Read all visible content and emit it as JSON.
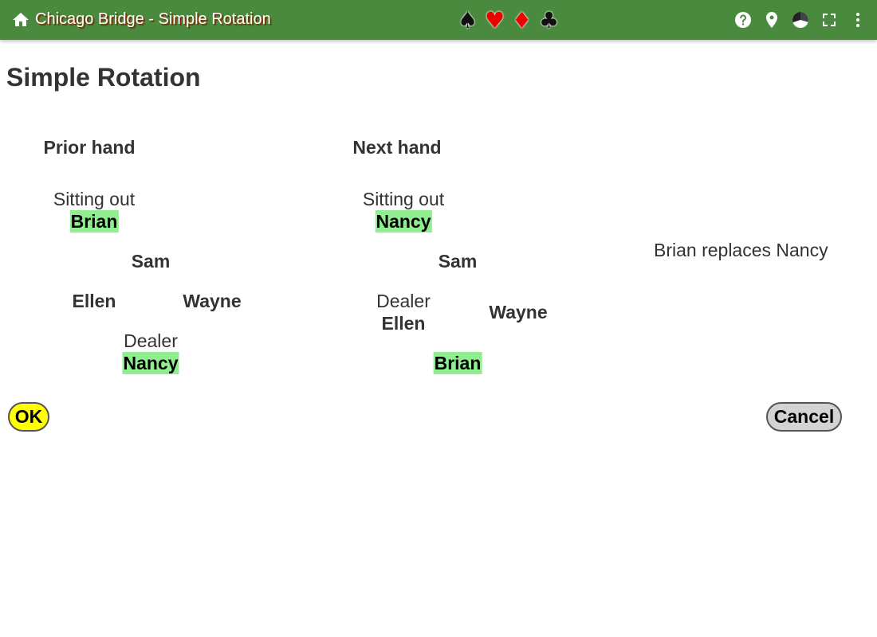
{
  "app_bar": {
    "title": "Chicago Bridge - Simple Rotation",
    "home_icon": "home-icon",
    "suits": [
      {
        "symbol": "♠",
        "name": "spade-icon",
        "color": "#111111"
      },
      {
        "symbol": "♥",
        "name": "heart-icon",
        "color": "#ee0000"
      },
      {
        "symbol": "♦",
        "name": "diamond-icon",
        "color": "#ee0000"
      },
      {
        "symbol": "♣",
        "name": "club-icon",
        "color": "#111111"
      }
    ],
    "action_icons": [
      "help-icon",
      "location-pin-icon",
      "pie-chart-icon",
      "fullscreen-icon",
      "more-vert-icon"
    ],
    "color": "#4a8a3f"
  },
  "page_title": "Simple Rotation",
  "prior_hand": {
    "heading": "Prior hand",
    "sitting_out_label": "Sitting out",
    "sitting_out": "Brian",
    "north": "Sam",
    "west": "Ellen",
    "east": "Wayne",
    "dealer_label": "Dealer",
    "south": "Nancy"
  },
  "next_hand": {
    "heading": "Next hand",
    "sitting_out_label": "Sitting out",
    "sitting_out": "Nancy",
    "north": "Sam",
    "dealer_label": "Dealer",
    "west": "Ellen",
    "east": "Wayne",
    "south": "Brian"
  },
  "summary": "Brian replaces Nancy",
  "buttons": {
    "ok": "OK",
    "cancel": "Cancel"
  },
  "colors": {
    "highlight": "#90ee90",
    "ok_button": "#ffff00",
    "cancel_button": "#d3d3d3"
  }
}
